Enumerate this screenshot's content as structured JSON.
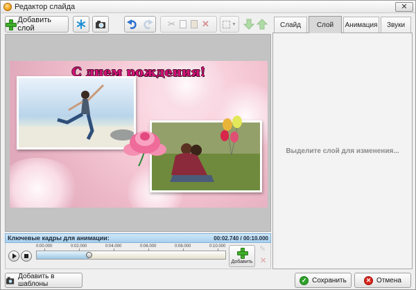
{
  "window": {
    "title": "Редактор слайда",
    "close_glyph": "✕"
  },
  "toolbar": {
    "add_layer_label": "Добавить слой",
    "icons": [
      "plus-icon",
      "snowflake-effect-icon",
      "photo-camera-icon",
      "undo-icon",
      "redo-icon",
      "cut-icon",
      "copy-icon",
      "paste-icon",
      "delete-icon",
      "align-icon",
      "move-down-icon",
      "move-up-icon"
    ]
  },
  "slide": {
    "title_text": "С днем рождения!"
  },
  "tabs": [
    {
      "label": "Слайд",
      "active": false
    },
    {
      "label": "Слой",
      "active": true
    },
    {
      "label": "Анимация",
      "active": false
    },
    {
      "label": "Звуки",
      "active": false
    }
  ],
  "properties_panel": {
    "placeholder": "Выделите слой для изменения..."
  },
  "keyframes": {
    "label": "Ключевые кадры для анимации:",
    "time_display": "00:02.740 / 00:10.000",
    "ticks": [
      "0:00.000",
      "0:02.000",
      "0:04.000",
      "0:06.000",
      "0:08.000",
      "0:10.000"
    ],
    "playhead_fraction": 0.274,
    "add_label": "Добавить"
  },
  "footer": {
    "add_to_templates_label": "Добавить в шаблоны",
    "save_label": "Сохранить",
    "cancel_label": "Отмена"
  },
  "colors": {
    "title_pink": "#d8127a",
    "save_green": "#2fa12a",
    "cancel_red": "#d7251c",
    "keyframe_bar": "#a8d1ee"
  }
}
